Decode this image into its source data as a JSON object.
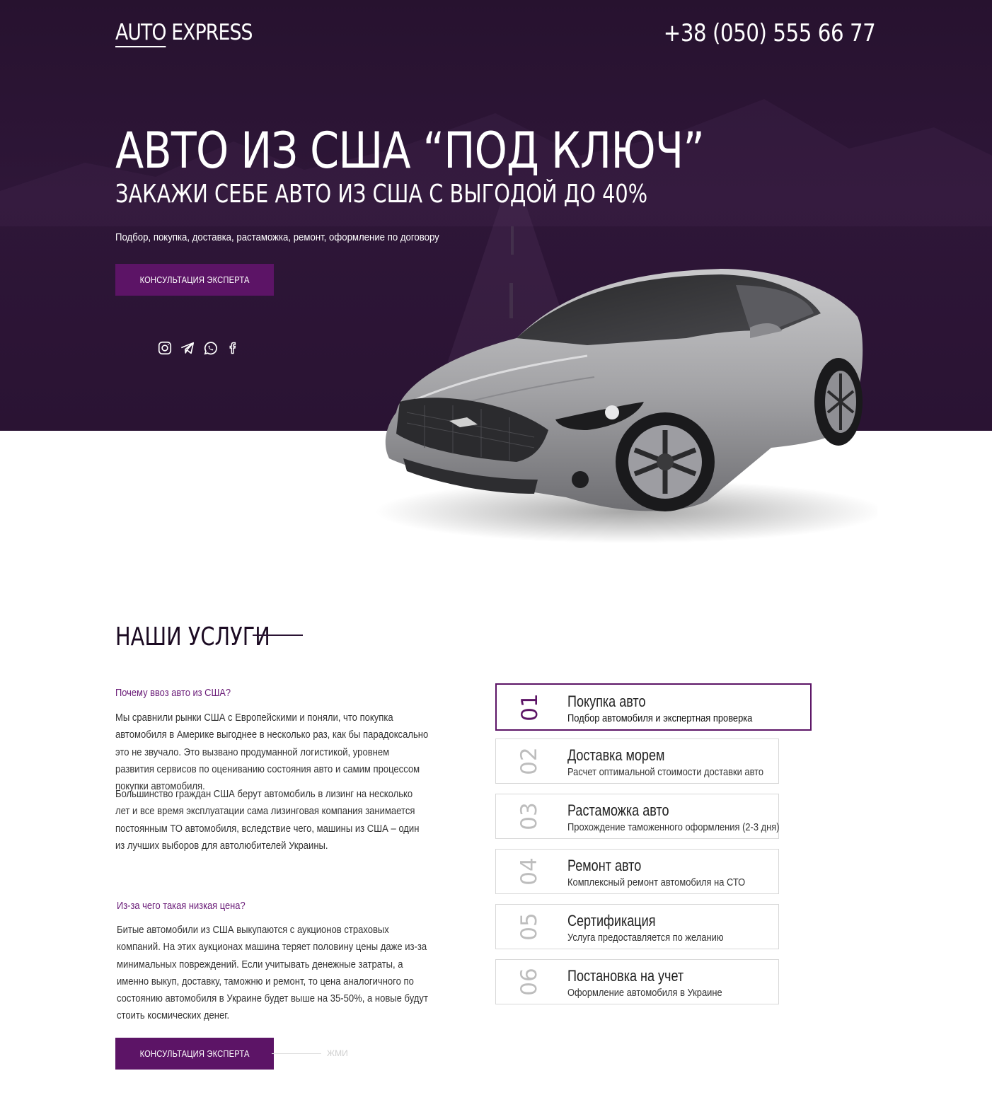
{
  "header": {
    "logo_part1": "AUTO",
    "logo_part2": " EXPRESS",
    "phone": "+38 (050) 555 66 77"
  },
  "hero": {
    "title": "АВТО ИЗ США “ПОД КЛЮЧ”",
    "subtitle": "ЗАКАЖИ СЕБЕ АВТО ИЗ США С ВЫГОДОЙ ДО 40%",
    "lead": "Подбор, покупка, доставка, растаможка, ремонт, оформление по договору",
    "cta_label": "КОНСУЛЬТАЦИЯ ЭКСПЕРТА",
    "socials": [
      "instagram-icon",
      "telegram-icon",
      "whatsapp-icon",
      "facebook-icon"
    ]
  },
  "services": {
    "title": "НАШИ УСЛУГИ",
    "q1": "Почему ввоз авто из США?",
    "p1": "Мы сравнили рынки США с Европейскими и поняли, что покупка автомобиля в Америке выгоднее в несколько раз, как бы парадоксально это не звучало. Это вызвано продуманной логистикой, уровнем развития сервисов по оцениванию состояния авто и самим процессом покупки автомобиля.",
    "p2": "Большинство граждан США берут автомобиль в лизинг на несколько лет и все время эксплуатации сама лизинговая компания занимается постоянным ТО автомобиля, вследствие чего, машины из США – один из лучших выборов для автолюбителей Украины.",
    "q2": "Из-за чего такая низкая цена?",
    "p3": "Битые автомобили из США выкупаются с аукционов страховых компаний. На этих аукционах машина теряет половину цены даже из-за минимальных повреждений. Если учитывать денежные затраты, а именно выкуп, доставку, таможню и ремонт, то цена аналогичного по состоянию автомобиля в Украине будет выше на 35-50%, а новые будут стоить космических денег.",
    "items": [
      {
        "num": "01",
        "title": "Покупка авто",
        "desc": "Подбор автомобиля и экспертная проверка"
      },
      {
        "num": "02",
        "title": "Доставка морем",
        "desc": "Расчет оптимальной стоимости доставки авто"
      },
      {
        "num": "03",
        "title": "Растаможка авто",
        "desc": "Прохождение таможенного оформления (2-3 дня)"
      },
      {
        "num": "04",
        "title": "Ремонт авто",
        "desc": "Комплексный ремонт автомобиля на  СТО"
      },
      {
        "num": "05",
        "title": "Сертификация",
        "desc": "Услуга предоставляется по желанию"
      },
      {
        "num": "06",
        "title": "Постановка на учет",
        "desc": "Оформление автомобиля в Украине"
      }
    ],
    "cta_label": "КОНСУЛЬТАЦИЯ ЭКСПЕРТА",
    "press_hint": "ЖМИ"
  },
  "colors": {
    "hero_bg": "#2b1434",
    "accent": "#5c1466",
    "accent_text": "#6a1c78"
  }
}
